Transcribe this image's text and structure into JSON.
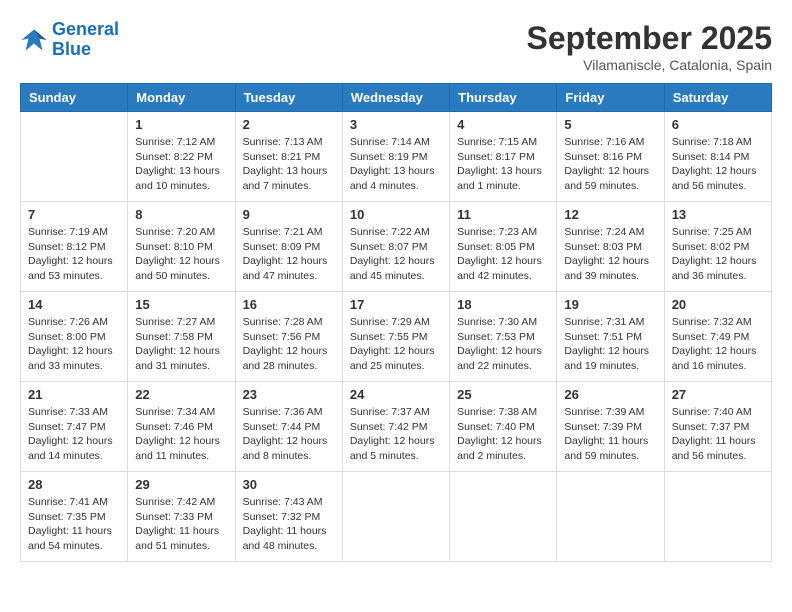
{
  "header": {
    "logo_line1": "General",
    "logo_line2": "Blue",
    "title": "September 2025",
    "subtitle": "Vilamaniscle, Catalonia, Spain"
  },
  "days_of_week": [
    "Sunday",
    "Monday",
    "Tuesday",
    "Wednesday",
    "Thursday",
    "Friday",
    "Saturday"
  ],
  "weeks": [
    [
      {
        "day": "",
        "sunrise": "",
        "sunset": "",
        "daylight": ""
      },
      {
        "day": "1",
        "sunrise": "Sunrise: 7:12 AM",
        "sunset": "Sunset: 8:22 PM",
        "daylight": "Daylight: 13 hours and 10 minutes."
      },
      {
        "day": "2",
        "sunrise": "Sunrise: 7:13 AM",
        "sunset": "Sunset: 8:21 PM",
        "daylight": "Daylight: 13 hours and 7 minutes."
      },
      {
        "day": "3",
        "sunrise": "Sunrise: 7:14 AM",
        "sunset": "Sunset: 8:19 PM",
        "daylight": "Daylight: 13 hours and 4 minutes."
      },
      {
        "day": "4",
        "sunrise": "Sunrise: 7:15 AM",
        "sunset": "Sunset: 8:17 PM",
        "daylight": "Daylight: 13 hours and 1 minute."
      },
      {
        "day": "5",
        "sunrise": "Sunrise: 7:16 AM",
        "sunset": "Sunset: 8:16 PM",
        "daylight": "Daylight: 12 hours and 59 minutes."
      },
      {
        "day": "6",
        "sunrise": "Sunrise: 7:18 AM",
        "sunset": "Sunset: 8:14 PM",
        "daylight": "Daylight: 12 hours and 56 minutes."
      }
    ],
    [
      {
        "day": "7",
        "sunrise": "Sunrise: 7:19 AM",
        "sunset": "Sunset: 8:12 PM",
        "daylight": "Daylight: 12 hours and 53 minutes."
      },
      {
        "day": "8",
        "sunrise": "Sunrise: 7:20 AM",
        "sunset": "Sunset: 8:10 PM",
        "daylight": "Daylight: 12 hours and 50 minutes."
      },
      {
        "day": "9",
        "sunrise": "Sunrise: 7:21 AM",
        "sunset": "Sunset: 8:09 PM",
        "daylight": "Daylight: 12 hours and 47 minutes."
      },
      {
        "day": "10",
        "sunrise": "Sunrise: 7:22 AM",
        "sunset": "Sunset: 8:07 PM",
        "daylight": "Daylight: 12 hours and 45 minutes."
      },
      {
        "day": "11",
        "sunrise": "Sunrise: 7:23 AM",
        "sunset": "Sunset: 8:05 PM",
        "daylight": "Daylight: 12 hours and 42 minutes."
      },
      {
        "day": "12",
        "sunrise": "Sunrise: 7:24 AM",
        "sunset": "Sunset: 8:03 PM",
        "daylight": "Daylight: 12 hours and 39 minutes."
      },
      {
        "day": "13",
        "sunrise": "Sunrise: 7:25 AM",
        "sunset": "Sunset: 8:02 PM",
        "daylight": "Daylight: 12 hours and 36 minutes."
      }
    ],
    [
      {
        "day": "14",
        "sunrise": "Sunrise: 7:26 AM",
        "sunset": "Sunset: 8:00 PM",
        "daylight": "Daylight: 12 hours and 33 minutes."
      },
      {
        "day": "15",
        "sunrise": "Sunrise: 7:27 AM",
        "sunset": "Sunset: 7:58 PM",
        "daylight": "Daylight: 12 hours and 31 minutes."
      },
      {
        "day": "16",
        "sunrise": "Sunrise: 7:28 AM",
        "sunset": "Sunset: 7:56 PM",
        "daylight": "Daylight: 12 hours and 28 minutes."
      },
      {
        "day": "17",
        "sunrise": "Sunrise: 7:29 AM",
        "sunset": "Sunset: 7:55 PM",
        "daylight": "Daylight: 12 hours and 25 minutes."
      },
      {
        "day": "18",
        "sunrise": "Sunrise: 7:30 AM",
        "sunset": "Sunset: 7:53 PM",
        "daylight": "Daylight: 12 hours and 22 minutes."
      },
      {
        "day": "19",
        "sunrise": "Sunrise: 7:31 AM",
        "sunset": "Sunset: 7:51 PM",
        "daylight": "Daylight: 12 hours and 19 minutes."
      },
      {
        "day": "20",
        "sunrise": "Sunrise: 7:32 AM",
        "sunset": "Sunset: 7:49 PM",
        "daylight": "Daylight: 12 hours and 16 minutes."
      }
    ],
    [
      {
        "day": "21",
        "sunrise": "Sunrise: 7:33 AM",
        "sunset": "Sunset: 7:47 PM",
        "daylight": "Daylight: 12 hours and 14 minutes."
      },
      {
        "day": "22",
        "sunrise": "Sunrise: 7:34 AM",
        "sunset": "Sunset: 7:46 PM",
        "daylight": "Daylight: 12 hours and 11 minutes."
      },
      {
        "day": "23",
        "sunrise": "Sunrise: 7:36 AM",
        "sunset": "Sunset: 7:44 PM",
        "daylight": "Daylight: 12 hours and 8 minutes."
      },
      {
        "day": "24",
        "sunrise": "Sunrise: 7:37 AM",
        "sunset": "Sunset: 7:42 PM",
        "daylight": "Daylight: 12 hours and 5 minutes."
      },
      {
        "day": "25",
        "sunrise": "Sunrise: 7:38 AM",
        "sunset": "Sunset: 7:40 PM",
        "daylight": "Daylight: 12 hours and 2 minutes."
      },
      {
        "day": "26",
        "sunrise": "Sunrise: 7:39 AM",
        "sunset": "Sunset: 7:39 PM",
        "daylight": "Daylight: 11 hours and 59 minutes."
      },
      {
        "day": "27",
        "sunrise": "Sunrise: 7:40 AM",
        "sunset": "Sunset: 7:37 PM",
        "daylight": "Daylight: 11 hours and 56 minutes."
      }
    ],
    [
      {
        "day": "28",
        "sunrise": "Sunrise: 7:41 AM",
        "sunset": "Sunset: 7:35 PM",
        "daylight": "Daylight: 11 hours and 54 minutes."
      },
      {
        "day": "29",
        "sunrise": "Sunrise: 7:42 AM",
        "sunset": "Sunset: 7:33 PM",
        "daylight": "Daylight: 11 hours and 51 minutes."
      },
      {
        "day": "30",
        "sunrise": "Sunrise: 7:43 AM",
        "sunset": "Sunset: 7:32 PM",
        "daylight": "Daylight: 11 hours and 48 minutes."
      },
      {
        "day": "",
        "sunrise": "",
        "sunset": "",
        "daylight": ""
      },
      {
        "day": "",
        "sunrise": "",
        "sunset": "",
        "daylight": ""
      },
      {
        "day": "",
        "sunrise": "",
        "sunset": "",
        "daylight": ""
      },
      {
        "day": "",
        "sunrise": "",
        "sunset": "",
        "daylight": ""
      }
    ]
  ]
}
